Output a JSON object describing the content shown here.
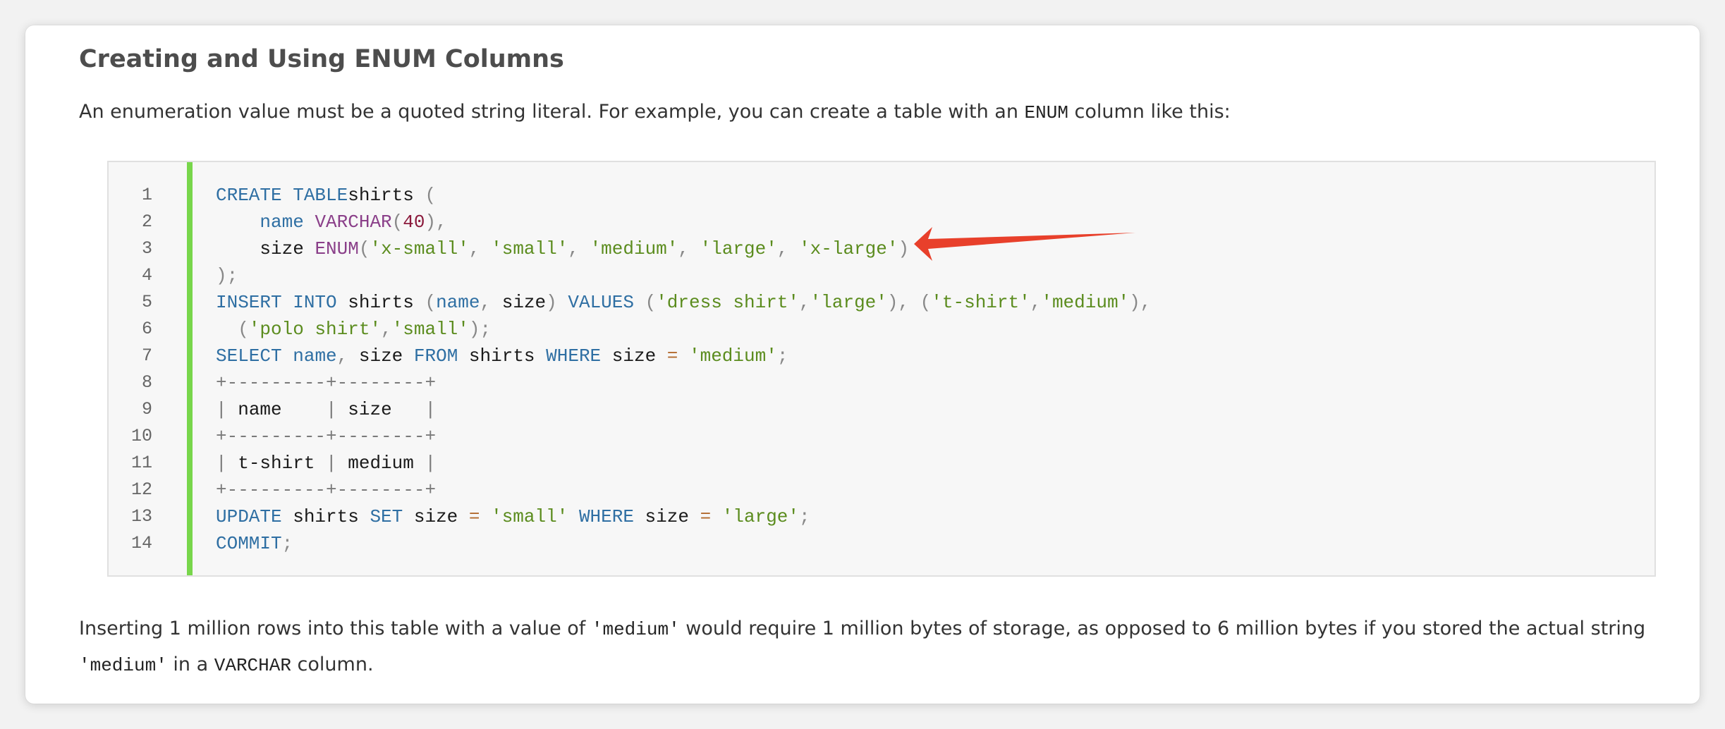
{
  "title": "Creating and Using ENUM Columns",
  "intro": {
    "before": "An enumeration value must be a quoted string literal. For example, you can create a table with an ",
    "code": "ENUM",
    "after": " column like this:"
  },
  "line_numbers": [
    "1",
    "2",
    "3",
    "4",
    "5",
    "6",
    "7",
    "8",
    "9",
    "10",
    "11",
    "12",
    "13",
    "14"
  ],
  "code_lines": [
    [
      [
        "kw",
        "CREATE TABLE"
      ],
      [
        "",
        "shirts "
      ],
      [
        "pn",
        "("
      ]
    ],
    [
      [
        "",
        "    "
      ],
      [
        "kw",
        "name"
      ],
      [
        "",
        ""
      ],
      [
        "fn",
        " VARCHAR"
      ],
      [
        "pn",
        "("
      ],
      [
        "num",
        "40"
      ],
      [
        "pn",
        "),"
      ]
    ],
    [
      [
        "",
        "    size "
      ],
      [
        "fn",
        "ENUM"
      ],
      [
        "pn",
        "("
      ],
      [
        "str",
        "'x-small'"
      ],
      [
        "pn",
        ", "
      ],
      [
        "str",
        "'small'"
      ],
      [
        "pn",
        ", "
      ],
      [
        "str",
        "'medium'"
      ],
      [
        "pn",
        ", "
      ],
      [
        "str",
        "'large'"
      ],
      [
        "pn",
        ", "
      ],
      [
        "str",
        "'x-large'"
      ],
      [
        "pn",
        ")"
      ]
    ],
    [
      [
        "pn",
        ");"
      ]
    ],
    [
      [
        "kw",
        "INSERT INTO"
      ],
      [
        "",
        " shirts "
      ],
      [
        "pn",
        "("
      ],
      [
        "kw",
        "name"
      ],
      [
        "pn",
        ", "
      ],
      [
        "",
        "size"
      ],
      [
        "pn",
        ") "
      ],
      [
        "kw",
        "VALUES"
      ],
      [
        "pn",
        " ("
      ],
      [
        "str",
        "'dress shirt'"
      ],
      [
        "pn",
        ","
      ],
      [
        "str",
        "'large'"
      ],
      [
        "pn",
        "), ("
      ],
      [
        "str",
        "'t-shirt'"
      ],
      [
        "pn",
        ","
      ],
      [
        "str",
        "'medium'"
      ],
      [
        "pn",
        "),"
      ]
    ],
    [
      [
        "pn",
        "  ("
      ],
      [
        "str",
        "'polo shirt'"
      ],
      [
        "pn",
        ","
      ],
      [
        "str",
        "'small'"
      ],
      [
        "pn",
        ");"
      ]
    ],
    [
      [
        "kw",
        "SELECT"
      ],
      [
        "",
        " "
      ],
      [
        "kw",
        "name"
      ],
      [
        "pn",
        ", "
      ],
      [
        "",
        "size "
      ],
      [
        "kw",
        "FROM"
      ],
      [
        "",
        " shirts "
      ],
      [
        "kw",
        "WHERE"
      ],
      [
        "",
        " size "
      ],
      [
        "op",
        "="
      ],
      [
        "str",
        " 'medium'"
      ],
      [
        "pn",
        ";"
      ]
    ],
    [
      [
        "tbl",
        "+---------+--------+"
      ]
    ],
    [
      [
        "tbl",
        "| "
      ],
      [
        "",
        "name"
      ],
      [
        "tbl",
        "    | "
      ],
      [
        "",
        "size"
      ],
      [
        "tbl",
        "   |"
      ]
    ],
    [
      [
        "tbl",
        "+---------+--------+"
      ]
    ],
    [
      [
        "tbl",
        "| "
      ],
      [
        "",
        "t-shirt"
      ],
      [
        "tbl",
        " | "
      ],
      [
        "",
        "medium"
      ],
      [
        "tbl",
        " |"
      ]
    ],
    [
      [
        "tbl",
        "+---------+--------+"
      ]
    ],
    [
      [
        "kw",
        "UPDATE"
      ],
      [
        "",
        " shirts "
      ],
      [
        "kw",
        "SET"
      ],
      [
        "",
        " size "
      ],
      [
        "op",
        "="
      ],
      [
        "str",
        " 'small'"
      ],
      [
        "",
        " "
      ],
      [
        "kw",
        "WHERE"
      ],
      [
        "",
        " size "
      ],
      [
        "op",
        "="
      ],
      [
        "str",
        " 'large'"
      ],
      [
        "pn",
        ";"
      ]
    ],
    [
      [
        "kw",
        "COMMIT"
      ],
      [
        "pn",
        ";"
      ]
    ]
  ],
  "outro": {
    "p1": "Inserting 1 million rows into this table with a value of ",
    "code1": "'medium'",
    "p2": " would require 1 million bytes of storage, as opposed to 6 million bytes if you stored the actual string",
    "code2": "'medium'",
    "p3": " in a ",
    "code3": "VARCHAR",
    "p4": " column."
  },
  "colors": {
    "accent_bar": "#78d64b",
    "arrow": "#e8402b",
    "keyword": "#2f6fa3",
    "function": "#8a3f89",
    "string": "#5b8c1e"
  },
  "annotation_icon": "red-arrow-icon"
}
